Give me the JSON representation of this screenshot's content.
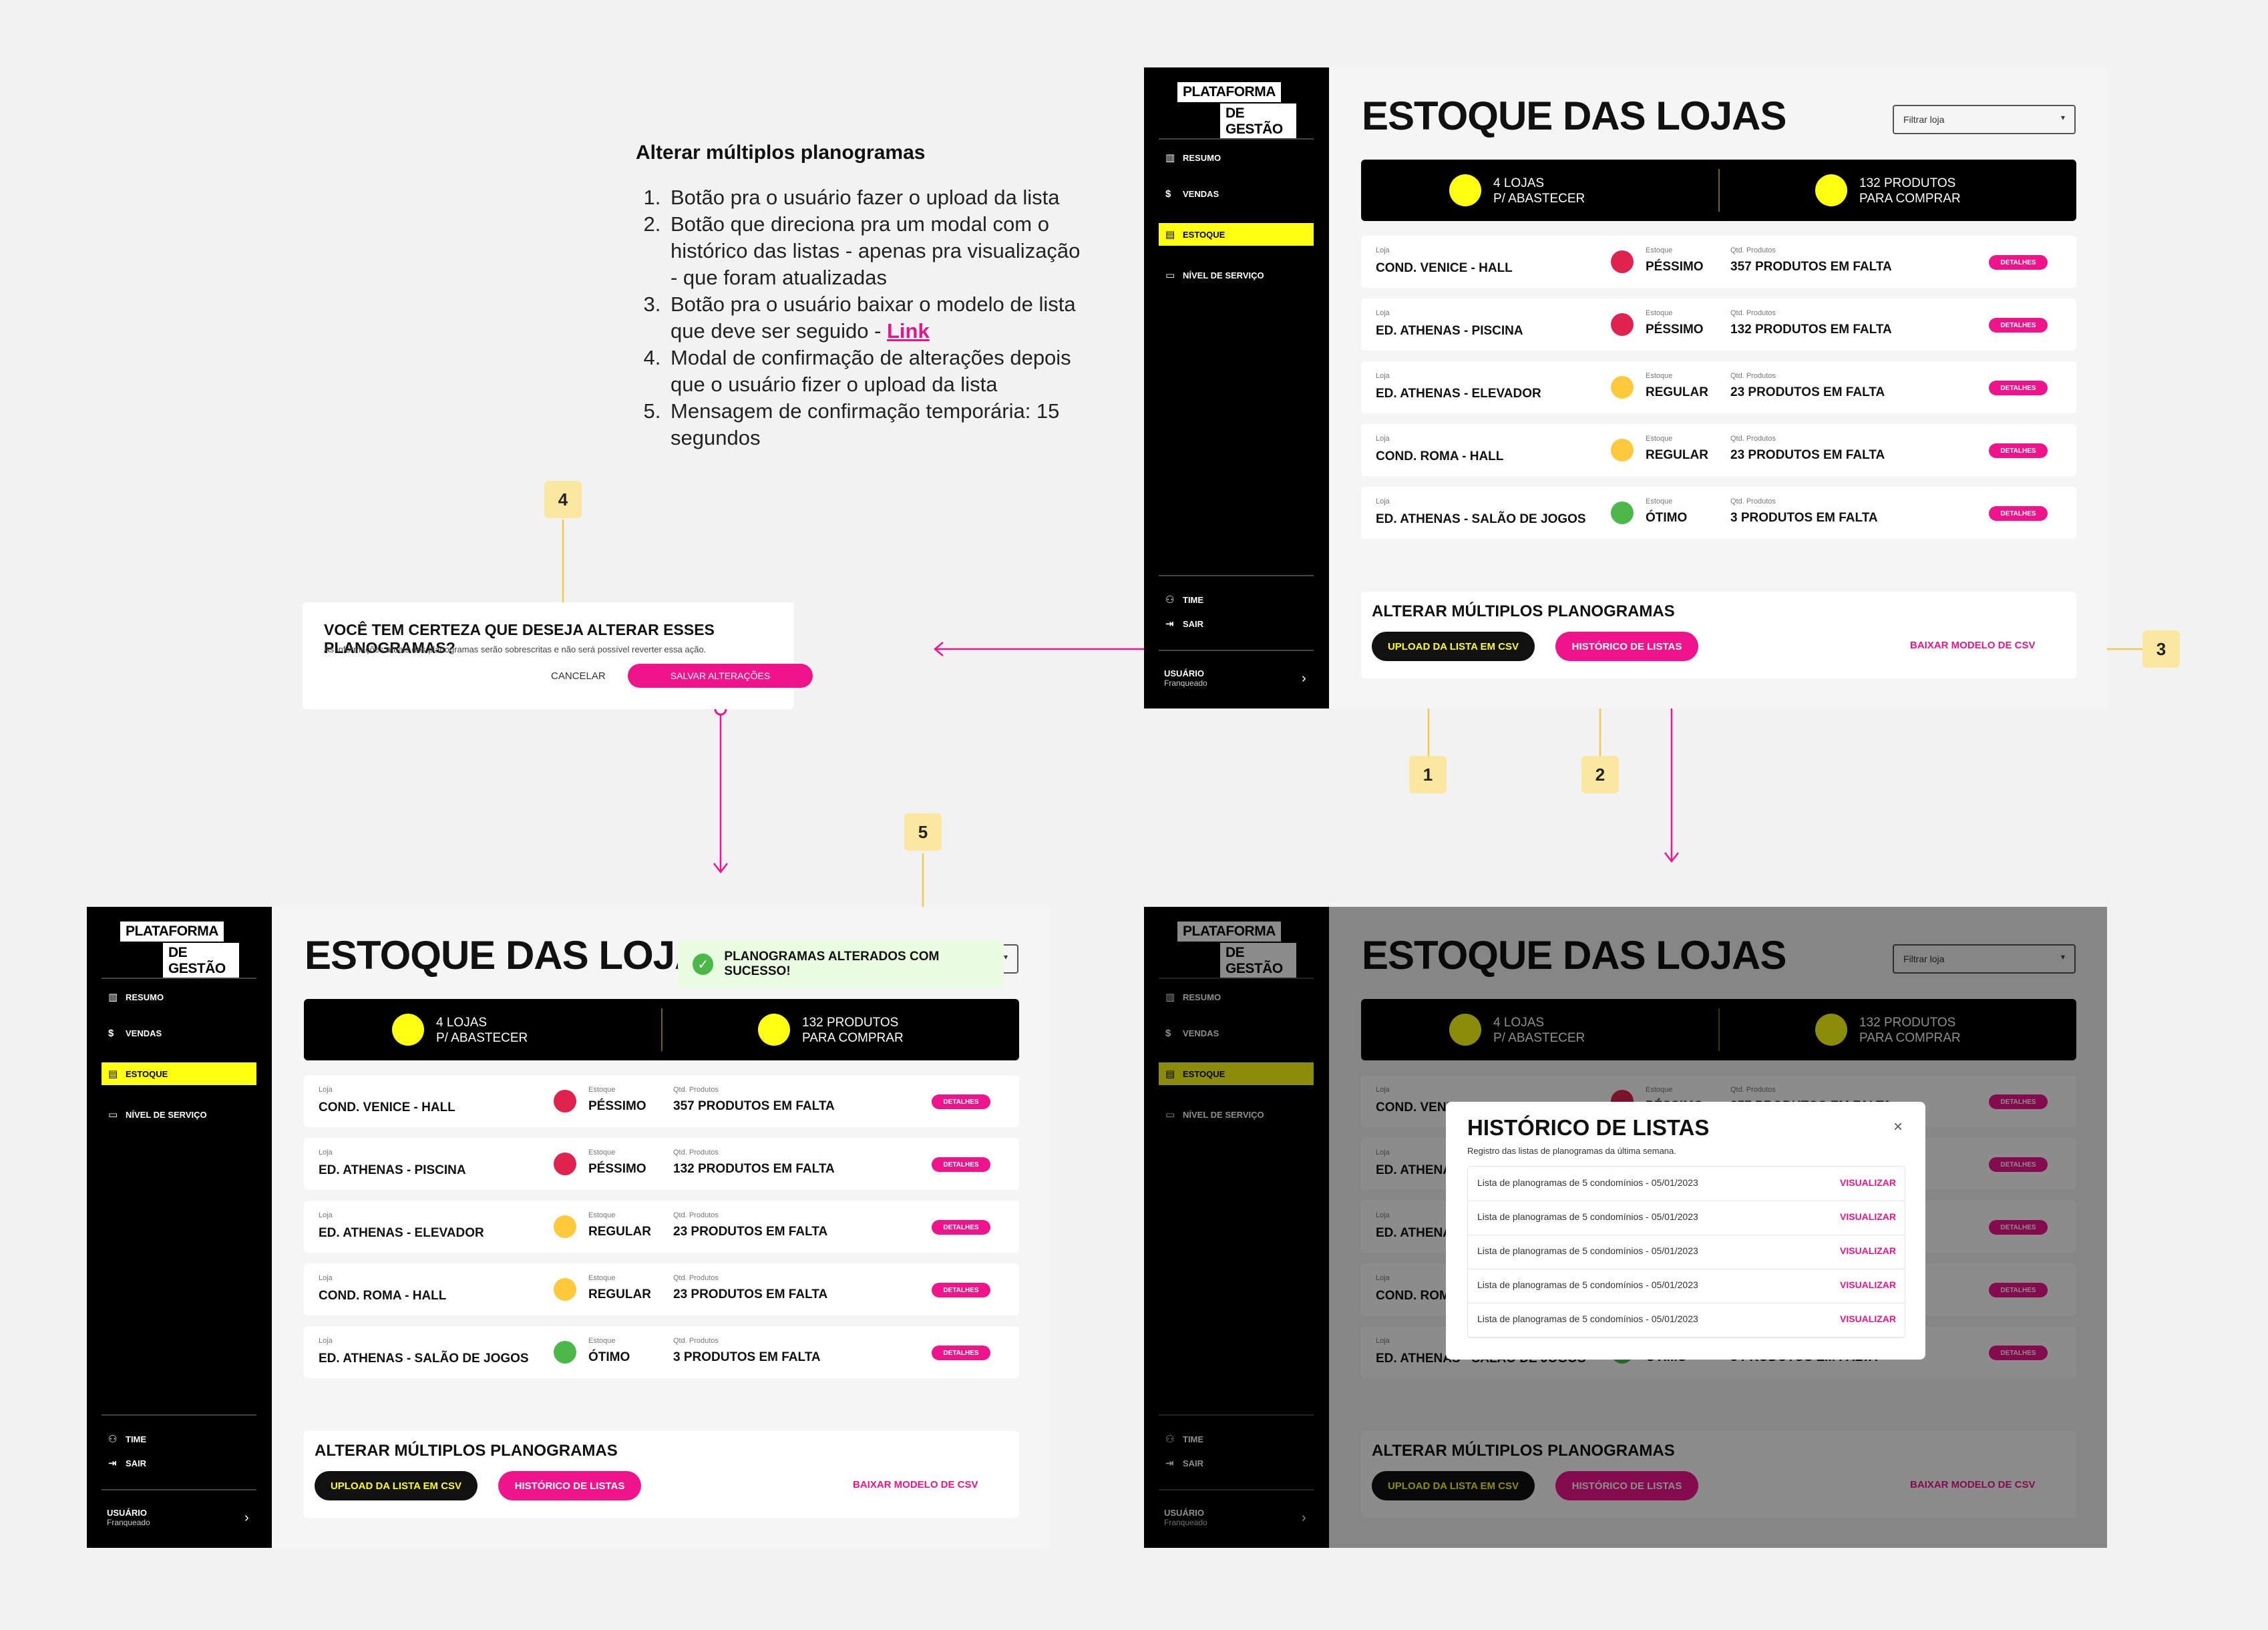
{
  "notes": {
    "title": "Alterar múltiplos planogramas",
    "items": [
      {
        "pre": "Botão pra o usuário fazer o upload da lista",
        "link": ""
      },
      {
        "pre": "Botão que direciona pra um modal com o histórico das listas - apenas pra visualização - que foram atualizadas",
        "link": ""
      },
      {
        "pre": "Botão pra o usuário baixar o modelo de lista que deve ser seguido - ",
        "link": "Link"
      },
      {
        "pre": "Modal de confirmação de alterações depois que o usuário fizer o upload da lista",
        "link": ""
      },
      {
        "pre": "Mensagem de confirmação temporária: 15 segundos",
        "link": ""
      }
    ]
  },
  "badges": [
    "1",
    "2",
    "3",
    "4",
    "5"
  ],
  "colors": {
    "accent_yellow": "#ffff14",
    "accent_pink": "#f0148c",
    "sidebar": "#000000",
    "status_bad": "#e0234e",
    "status_regular": "#ffc93c",
    "status_good": "#4cb84a"
  },
  "app": {
    "logo": [
      "PLATAFORMA",
      "DE GESTÃO"
    ],
    "nav": [
      {
        "icon": "bar-chart-icon",
        "glyph": "▥",
        "label": "RESUMO"
      },
      {
        "icon": "dollar-icon",
        "glyph": "$",
        "label": "VENDAS"
      },
      {
        "icon": "inventory-icon",
        "glyph": "▤",
        "label": "ESTOQUE"
      },
      {
        "icon": "chat-icon",
        "glyph": "▭",
        "label": "NÍVEL DE SERVIÇO"
      }
    ],
    "bottom_nav": [
      {
        "icon": "team-icon",
        "glyph": "⚇",
        "label": "TIME"
      },
      {
        "icon": "logout-icon",
        "glyph": "⇥",
        "label": "SAIR"
      }
    ],
    "user": {
      "name": "USUÁRIO",
      "role": "Franqueado",
      "arrow": "›"
    },
    "page_title": "ESTOQUE DAS LOJAS",
    "filter_placeholder": "Filtrar loja",
    "kpis": [
      {
        "line1": "4 LOJAS",
        "line2": "P/ ABASTECER"
      },
      {
        "line1": "132 PRODUTOS",
        "line2": "PARA COMPRAR"
      }
    ],
    "col_labels": {
      "loja": "Loja",
      "estoque": "Estoque",
      "qtd": "Qtd. Produtos",
      "detalhes": "DETALHES"
    },
    "stores": [
      {
        "name": "COND. VENICE - HALL",
        "status": "PÉSSIMO",
        "status_color": "#e0234e",
        "missing": "357 PRODUTOS EM FALTA"
      },
      {
        "name": "ED. ATHENAS - PISCINA",
        "status": "PÉSSIMO",
        "status_color": "#e0234e",
        "missing": "132 PRODUTOS EM FALTA"
      },
      {
        "name": "ED. ATHENAS - ELEVADOR",
        "status": "REGULAR",
        "status_color": "#ffc93c",
        "missing": "23 PRODUTOS EM FALTA"
      },
      {
        "name": "COND. ROMA - HALL",
        "status": "REGULAR",
        "status_color": "#ffc93c",
        "missing": "23 PRODUTOS EM FALTA"
      },
      {
        "name": "ED. ATHENAS - SALÃO DE JOGOS",
        "status": "ÓTIMO",
        "status_color": "#4cb84a",
        "missing": "3 PRODUTOS EM FALTA"
      }
    ],
    "alterar": {
      "title": "ALTERAR MÚLTIPLOS PLANOGRAMAS",
      "upload": "UPLOAD DA LISTA EM CSV",
      "historico": "HISTÓRICO DE LISTAS",
      "baixar": "BAIXAR MODELO DE CSV"
    }
  },
  "confirm": {
    "question": "VOCÊ TEM CERTEZA QUE DESEJA ALTERAR ESSES PLANOGRAMAS?",
    "info": "As informações atuais dos planogramas serão sobrescritas e não será possível reverter essa ação.",
    "cancel": "CANCELAR",
    "save": "SALVAR ALTERAÇÕES"
  },
  "toast": {
    "icon": "check-icon",
    "glyph": "✓",
    "text": "PLANOGRAMAS ALTERADOS COM SUCESSO!"
  },
  "history_modal": {
    "title": "HISTÓRICO DE LISTAS",
    "subtitle": "Registro das listas de planogramas da última semana.",
    "close": "×",
    "rows": [
      {
        "name": "Lista de planogramas de 5 condomínios - 05/01/2023",
        "action": "VISUALIZAR"
      },
      {
        "name": "Lista de planogramas de 5 condomínios - 05/01/2023",
        "action": "VISUALIZAR"
      },
      {
        "name": "Lista de planogramas de 5 condomínios - 05/01/2023",
        "action": "VISUALIZAR"
      },
      {
        "name": "Lista de planogramas de 5 condomínios - 05/01/2023",
        "action": "VISUALIZAR"
      },
      {
        "name": "Lista de planogramas de 5 condomínios - 05/01/2023",
        "action": "VISUALIZAR"
      }
    ]
  }
}
